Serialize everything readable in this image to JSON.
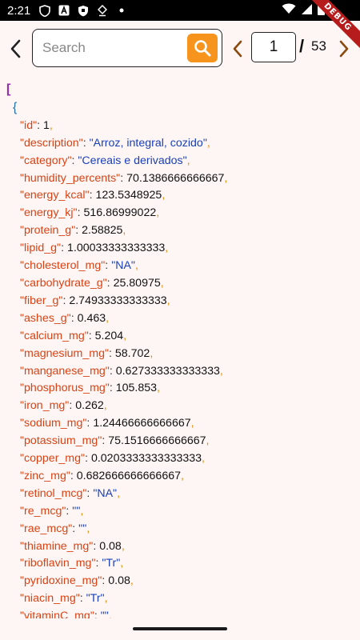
{
  "status_bar": {
    "time": "2:21",
    "icons": [
      "shield-icon",
      "a-icon",
      "shield-icon",
      "download-icon",
      "dot-icon"
    ],
    "right_icons": [
      "wifi-icon",
      "signal-icon",
      "battery-icon"
    ],
    "debug_label": "DEBUG"
  },
  "toolbar": {
    "search_placeholder": "Search",
    "search_value": "",
    "current_page": "1",
    "separator": "/",
    "total_pages": "53"
  },
  "json": {
    "open_bracket": "[",
    "open_brace": "{",
    "rows": [
      {
        "key": "\"id\"",
        "value": "1",
        "kind": "num"
      },
      {
        "key": "\"description\"",
        "value": "\"Arroz, integral, cozido\"",
        "kind": "str"
      },
      {
        "key": "\"category\"",
        "value": "\"Cereais e derivados\"",
        "kind": "str"
      },
      {
        "key": "\"humidity_percents\"",
        "value": "70.1386666666667",
        "kind": "num"
      },
      {
        "key": "\"energy_kcal\"",
        "value": "123.5348925",
        "kind": "num"
      },
      {
        "key": "\"energy_kj\"",
        "value": "516.86999022",
        "kind": "num"
      },
      {
        "key": "\"protein_g\"",
        "value": "2.58825",
        "kind": "num"
      },
      {
        "key": "\"lipid_g\"",
        "value": "1.00033333333333",
        "kind": "num"
      },
      {
        "key": "\"cholesterol_mg\"",
        "value": "\"NA\"",
        "kind": "str"
      },
      {
        "key": "\"carbohydrate_g\"",
        "value": "25.80975",
        "kind": "num"
      },
      {
        "key": "\"fiber_g\"",
        "value": "2.74933333333333",
        "kind": "num"
      },
      {
        "key": "\"ashes_g\"",
        "value": "0.463",
        "kind": "num"
      },
      {
        "key": "\"calcium_mg\"",
        "value": "5.204",
        "kind": "num"
      },
      {
        "key": "\"magnesium_mg\"",
        "value": "58.702",
        "kind": "num"
      },
      {
        "key": "\"manganese_mg\"",
        "value": "0.627333333333333",
        "kind": "num"
      },
      {
        "key": "\"phosphorus_mg\"",
        "value": "105.853",
        "kind": "num"
      },
      {
        "key": "\"iron_mg\"",
        "value": "0.262",
        "kind": "num"
      },
      {
        "key": "\"sodium_mg\"",
        "value": "1.24466666666667",
        "kind": "num"
      },
      {
        "key": "\"potassium_mg\"",
        "value": "75.1516666666667",
        "kind": "num"
      },
      {
        "key": "\"copper_mg\"",
        "value": "0.0203333333333333",
        "kind": "num"
      },
      {
        "key": "\"zinc_mg\"",
        "value": "0.682666666666667",
        "kind": "num"
      },
      {
        "key": "\"retinol_mcg\"",
        "value": "\"NA\"",
        "kind": "str"
      },
      {
        "key": "\"re_mcg\"",
        "value": "\"\"",
        "kind": "str"
      },
      {
        "key": "\"rae_mcg\"",
        "value": "\"\"",
        "kind": "str"
      },
      {
        "key": "\"thiamine_mg\"",
        "value": "0.08",
        "kind": "num"
      },
      {
        "key": "\"riboflavin_mg\"",
        "value": "\"Tr\"",
        "kind": "str"
      },
      {
        "key": "\"pyridoxine_mg\"",
        "value": "0.08",
        "kind": "num"
      },
      {
        "key": "\"niacin_mg\"",
        "value": "\"Tr\"",
        "kind": "str"
      },
      {
        "key": "\"vitaminC_mg\"",
        "value": "\"\"",
        "kind": "str"
      }
    ]
  },
  "colors": {
    "accent": "#f7941d",
    "key": "#d84315",
    "string": "#1a3fb8",
    "bracket": "#9c27b0"
  }
}
